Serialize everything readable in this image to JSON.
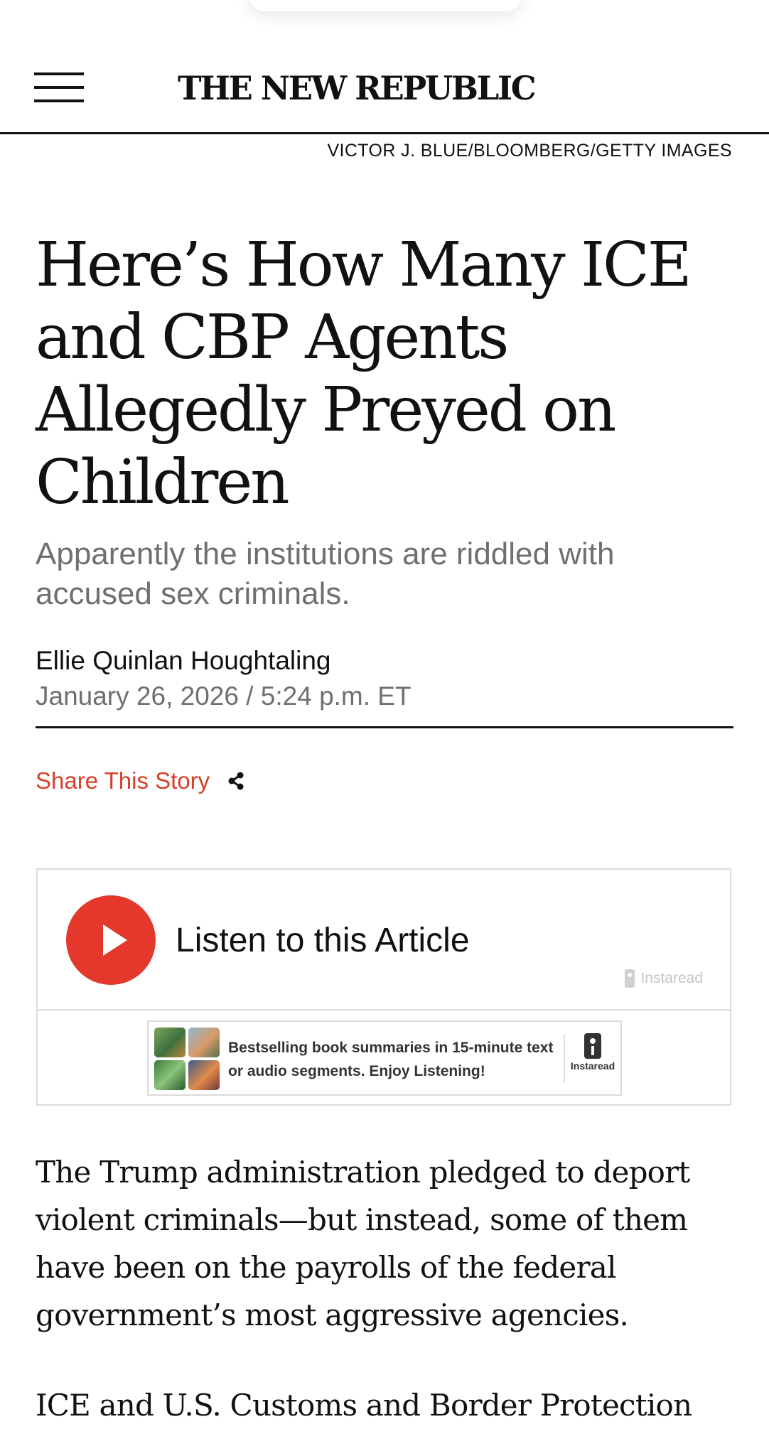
{
  "header": {
    "masthead": "THE NEW REPUBLIC"
  },
  "photo_credit": "VICTOR J. BLUE/BLOOMBERG/GETTY IMAGES",
  "article": {
    "headline": "Here’s How Many ICE and CBP Agents Allegedly Preyed on Children",
    "dek": "Apparently the institutions are riddled with accused sex criminals.",
    "author": "Ellie Quinlan Houghtaling",
    "date": "January 26, 2026",
    "separator": "/",
    "time": "5:24 p.m. ET",
    "share_label": "Share This Story",
    "paragraphs": [
      "The Trump administration pledged to deport violent criminals—but instead, some of them have been on the payrolls of the federal government’s most aggressive agencies.",
      "ICE and U.S. Customs and Border Protection"
    ]
  },
  "audio_player": {
    "listen_label": "Listen to this Article",
    "brand": "Instaread",
    "ad_text": "Bestselling book summaries in 15-minute text or audio segments. Enjoy Listening!",
    "ad_logo": "Instaread"
  },
  "colors": {
    "accent": "#d6402b",
    "play_button": "#e3382b",
    "muted_text": "#6f6f6f"
  },
  "icons": {
    "menu": "hamburger-menu-icon",
    "share": "share-icon",
    "play": "play-icon"
  }
}
